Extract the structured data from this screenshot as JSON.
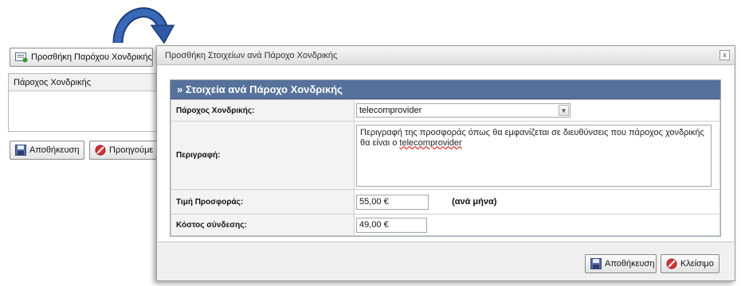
{
  "background": {
    "add_provider_button": "Προσθήκη Παρόχου Χονδρικής",
    "panel_header": "Πάροχος Χονδρικής",
    "save_button": "Αποθήκευση",
    "previous_button": "Προηγούμε"
  },
  "dialog": {
    "title": "Προσθήκη Στοιχείων ανά Πάροχο Χονδρικής",
    "close_glyph": "x",
    "section_title": "» Στοιχεία ανά Πάροχο Χονδρικής",
    "fields": {
      "provider_label": "Πάροχος Χονδρικής:",
      "provider_value": "telecomprovider",
      "description_label": "Περιγραφή:",
      "description_text": "Περιγραφή της προσφοράς όπως θα εμφανίζεται σε διευθύνσεις που πάροχος χονδρικής θα είναι ο ",
      "description_provider": "telecomprovider",
      "price_label": "Τιμή Προσφοράς:",
      "price_value": "55,00 €",
      "price_period": "(ανά μήνα)",
      "connection_cost_label": "Κόστος σύνδεσης:",
      "connection_cost_value": "49,00 €"
    },
    "save_button": "Αποθήκευση",
    "close_button": "Κλείσιμο"
  },
  "colors": {
    "section_header": "#56729b",
    "arrow": "#2f5aa8"
  },
  "icons": [
    "curved-arrow-icon",
    "add-list-icon",
    "floppy-disk-icon",
    "cancel-icon",
    "close-icon",
    "chevron-down-icon"
  ]
}
